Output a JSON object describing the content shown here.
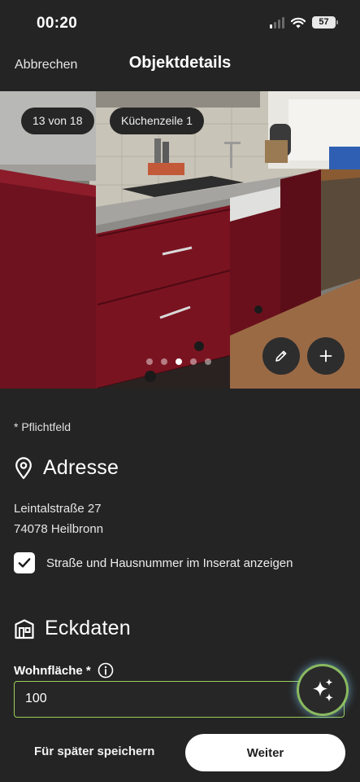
{
  "status_bar": {
    "time": "00:20",
    "battery": "57",
    "icons": [
      "cellular-signal-icon",
      "wifi-icon",
      "battery-icon"
    ]
  },
  "nav": {
    "cancel_label": "Abbrechen",
    "title": "Objektdetails"
  },
  "gallery": {
    "counter": "13 von 18",
    "room_label": "Küchenzeile 1",
    "dots": 5,
    "active_dot": 3,
    "actions": [
      "pencil-icon",
      "plus-icon"
    ]
  },
  "form": {
    "required_note": "* Pflichtfeld",
    "address": {
      "heading": "Adresse",
      "street": "Leintalstraße 27",
      "city": "74078 Heilbronn",
      "show_address_label": "Straße und Hausnummer im Inserat anzeigen",
      "show_address_checked": true
    },
    "key_data": {
      "heading": "Eckdaten",
      "living_area_label": "Wohnfläche *",
      "living_area_value": "100"
    }
  },
  "footer": {
    "save_later_label": "Für später speichern",
    "next_label": "Weiter"
  },
  "colors": {
    "background": "#242424",
    "field_border": "#9ad05a",
    "primary_button": "#ffffff",
    "cabinet": "#7a1320"
  }
}
